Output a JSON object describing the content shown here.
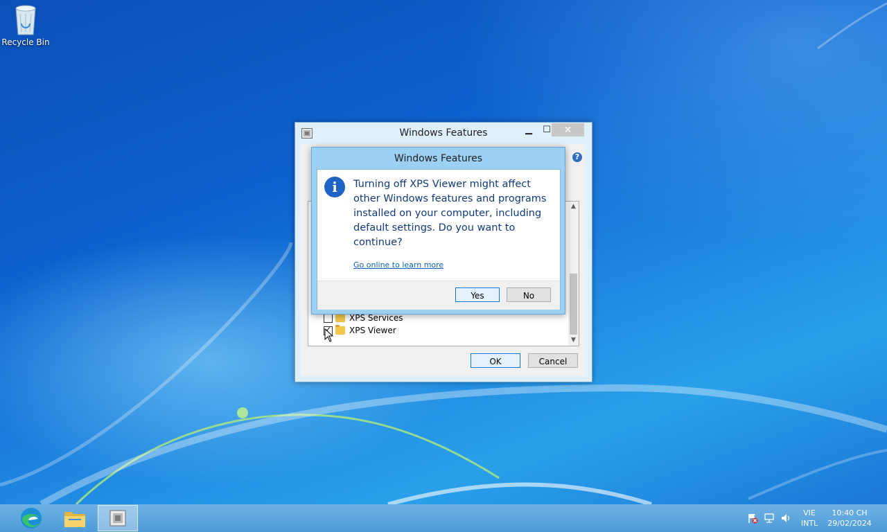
{
  "desktop": {
    "recycle_bin_label": "Recycle Bin"
  },
  "features_window": {
    "title": "Windows Features",
    "close_glyph": "✕",
    "minimize_glyph": "▁",
    "maximize_glyph": "☐",
    "help_glyph": "?",
    "items": [
      {
        "label": "XPS Services",
        "checked": false
      },
      {
        "label": "XPS Viewer",
        "checked": true
      }
    ],
    "ok_label": "OK",
    "cancel_label": "Cancel"
  },
  "confirm_dialog": {
    "title": "Windows Features",
    "message": "Turning off XPS Viewer might affect other Windows features and programs installed on your computer, including default settings. Do you want to continue?",
    "link": "Go online to learn more",
    "yes_label": "Yes",
    "no_label": "No",
    "info_glyph": "i"
  },
  "taskbar": {
    "language_line1": "VIE",
    "language_line2": "INTL",
    "time": "10:40 CH",
    "date": "29/02/2024"
  },
  "colors": {
    "accent": "#0078d7",
    "dialog_frame": "#9bd0f2",
    "taskbar": "#5ea7de"
  }
}
